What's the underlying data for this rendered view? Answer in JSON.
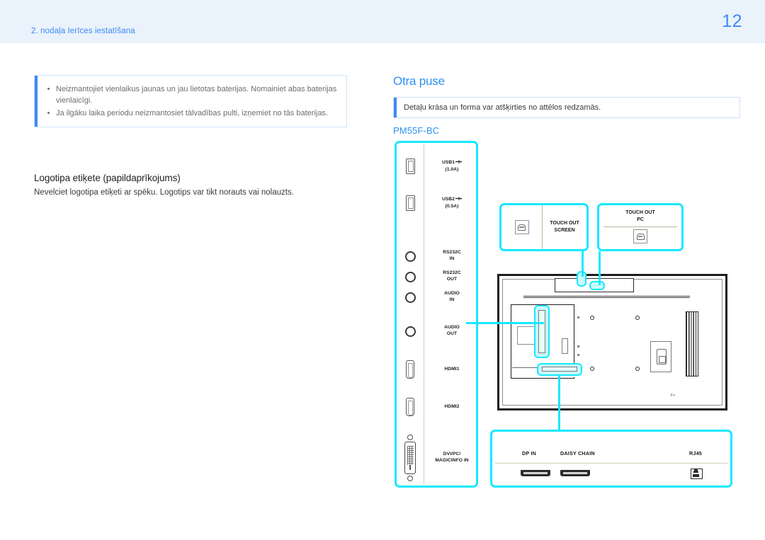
{
  "header": {
    "breadcrumb": "2. nodaļa Ierīces iestatīšana",
    "page_number": "12",
    "band_color": "#eaf2fb",
    "accent_color": "#3d8bf2"
  },
  "left": {
    "note": {
      "items": [
        "Neizmantojiet vienlaikus jaunas un jau lietotas baterijas. Nomainiet abas baterijas vienlaicīgi.",
        "Ja ilgāku laika periodu neizmantosiet tālvadības pulti, izņemiet no tās baterijas."
      ]
    },
    "logo_section": {
      "heading": "Logotipa etiķete (papildaprīkojums)",
      "body": "Nevelciet logotipa etiķeti ar spēku. Logotips var tikt norauts vai nolauzts."
    }
  },
  "right": {
    "section_title": "Otra puse",
    "note_text": "Detaļu krāsa un forma var atšķirties no attēlos redzamās.",
    "model_name": "PM55F-BC"
  },
  "figure": {
    "highlight_color": "#18e8ff",
    "port_strip": {
      "ports": [
        {
          "label_line1": "USB1",
          "label_line2": "(1.0A)",
          "icon": "usb-a-port-icon",
          "has_usb_mark": true
        },
        {
          "label_line1": "USB2",
          "label_line2": "(0.5A)",
          "icon": "usb-a-port-icon",
          "has_usb_mark": true
        },
        {
          "label_line1": "RS232C",
          "label_line2": "IN",
          "icon": "round-jack-icon",
          "has_usb_mark": false
        },
        {
          "label_line1": "RS232C",
          "label_line2": "OUT",
          "icon": "round-jack-icon",
          "has_usb_mark": false
        },
        {
          "label_line1": "AUDIO",
          "label_line2": "IN",
          "icon": "round-jack-icon",
          "has_usb_mark": false
        },
        {
          "label_line1": "AUDIO",
          "label_line2": "OUT",
          "icon": "round-jack-icon",
          "has_usb_mark": false
        },
        {
          "label_line1": "HDMI1",
          "label_line2": "",
          "icon": "hdmi-port-icon",
          "has_usb_mark": false
        },
        {
          "label_line1": "HDMI2",
          "label_line2": "",
          "icon": "hdmi-port-icon",
          "has_usb_mark": false
        },
        {
          "label_line1": "DVI/PC/",
          "label_line2": "MAGICINFO IN",
          "icon": "dvi-port-icon",
          "has_usb_mark": false
        }
      ]
    },
    "callout_touch_screen": {
      "label_line1": "TOUCH OUT",
      "label_line2": "SCREEN",
      "icon": "usb-b-port-icon"
    },
    "callout_touch_pc": {
      "label_line1": "TOUCH OUT",
      "label_line2": "PC",
      "icon": "usb-b-port-icon"
    },
    "callout_bottom": {
      "labels": [
        "DP IN",
        "DAISY CHAIN",
        "RJ45"
      ],
      "icons": [
        "displayport-icon",
        "displayport-icon",
        "rj45-icon"
      ]
    },
    "monitor": {
      "chip_label_a": "•••",
      "chip_label_b": "•••",
      "mini_label": "⌷▸"
    }
  }
}
